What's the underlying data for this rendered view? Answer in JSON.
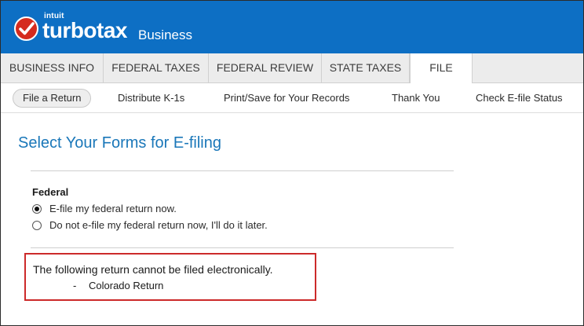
{
  "header": {
    "intuit_label": "intuit",
    "brand": "turbotax",
    "brand_sub": "Business",
    "brand_color": "#0d6fc4",
    "check_icon_color": "#d52b1e"
  },
  "tabs": [
    {
      "label": "BUSINESS INFO",
      "active": false
    },
    {
      "label": "FEDERAL TAXES",
      "active": false
    },
    {
      "label": "FEDERAL REVIEW",
      "active": false
    },
    {
      "label": "STATE TAXES",
      "active": false
    },
    {
      "label": "FILE",
      "active": true
    }
  ],
  "subnav": [
    {
      "label": "File a Return",
      "active": true
    },
    {
      "label": "Distribute K-1s",
      "active": false
    },
    {
      "label": "Print/Save for Your Records",
      "active": false
    },
    {
      "label": "Thank You",
      "active": false
    },
    {
      "label": "Check E-file Status",
      "active": false
    }
  ],
  "main": {
    "title": "Select Your Forms for E-filing",
    "title_color": "#1a77b9",
    "section_label": "Federal",
    "options": [
      {
        "label": "E-file my federal return now.",
        "selected": true
      },
      {
        "label": "Do not e-file my federal return now, I'll do it later.",
        "selected": false
      }
    ],
    "warning": {
      "text": "The following return cannot be filed electronically.",
      "dash": "-",
      "item": "Colorado Return",
      "border_color": "#cc2a2a"
    }
  }
}
